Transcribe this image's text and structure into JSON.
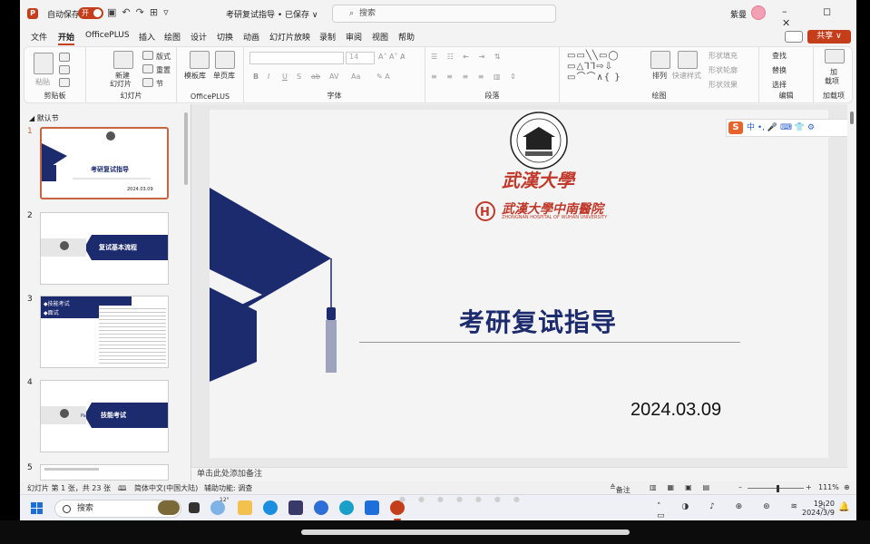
{
  "titlebar": {
    "app_icon": "P",
    "autosave_label": "自动保存",
    "autosave_state": "开",
    "doc_title": "考研复试指导 • 已保存 ∨",
    "search_placeholder": "搜索",
    "user_name": "紫曼",
    "window_buttons": "– ◻ ✕"
  },
  "menu": {
    "tabs": [
      "文件",
      "开始",
      "OfficePLUS",
      "插入",
      "绘图",
      "设计",
      "切换",
      "动画",
      "幻灯片放映",
      "录制",
      "审阅",
      "视图",
      "帮助"
    ],
    "active": "开始",
    "share_label": "共享 ∨"
  },
  "ribbon": {
    "groups": [
      "剪贴板",
      "幻灯片",
      "OfficePLUS",
      "字体",
      "段落",
      "绘图",
      "编辑",
      "加载项"
    ],
    "clipboard": {
      "paste": "粘贴"
    },
    "slides": {
      "new_slide": "新建",
      "new_slide2": "幻灯片",
      "layout": "版式",
      "reset": "重置",
      "section": "节"
    },
    "officeplus": {
      "template": "模板库",
      "single_page": "单页库"
    },
    "font": {
      "font_size": "14",
      "bold": "B",
      "italic": "I",
      "underline": "U",
      "strike": "S",
      "shadow": "ab",
      "spacing": "AV",
      "case": "Aa"
    },
    "drawing": {
      "arrange": "排列",
      "quick_styles": "快速样式",
      "fill": "形状填充",
      "outline": "形状轮廓",
      "effects": "形状效果"
    },
    "editing": {
      "find": "查找",
      "replace": "替换",
      "select": "选择"
    },
    "addins": {
      "addin1": "加",
      "addin2": "载项"
    }
  },
  "thumbnails": {
    "section": "默认节",
    "slides": [
      {
        "num": "1",
        "title": "考研复试指导",
        "date": "2024.03.09"
      },
      {
        "num": "2",
        "title": "复试基本流程"
      },
      {
        "num": "3",
        "title": "◆技能考试",
        "title2": "◆面试"
      },
      {
        "num": "4",
        "title": "技能考试",
        "part": "Part 1"
      },
      {
        "num": "5",
        "title": ""
      }
    ]
  },
  "slide": {
    "university_name": "武漢大學",
    "hospital_name_cn": "武漢大學中南醫院",
    "hospital_name_en": "ZHONGNAN HOSPITAL OF WUHAN UNIVERSITY",
    "title": "考研复试指导",
    "date": "2024.03.09"
  },
  "ime_toolbar": {
    "logo": "S",
    "mode": "中 •, 🎤 ⌨ 👕 ⚙"
  },
  "notes_placeholder": "单击此处添加备注",
  "status": {
    "slide_info": "幻灯片 第 1 张，共 23 张",
    "language": "简体中文(中国大陆)",
    "accessibility": "辅助功能: 调查",
    "notes": "备注",
    "zoom": "111%"
  },
  "taskbar": {
    "search_placeholder": "搜索",
    "weather_badge": "12°",
    "time": "19:20",
    "date": "2024/3/9"
  },
  "colors": {
    "accent": "#c43e1c",
    "navy": "#1c2a6e",
    "logo_red": "#c0392b"
  }
}
